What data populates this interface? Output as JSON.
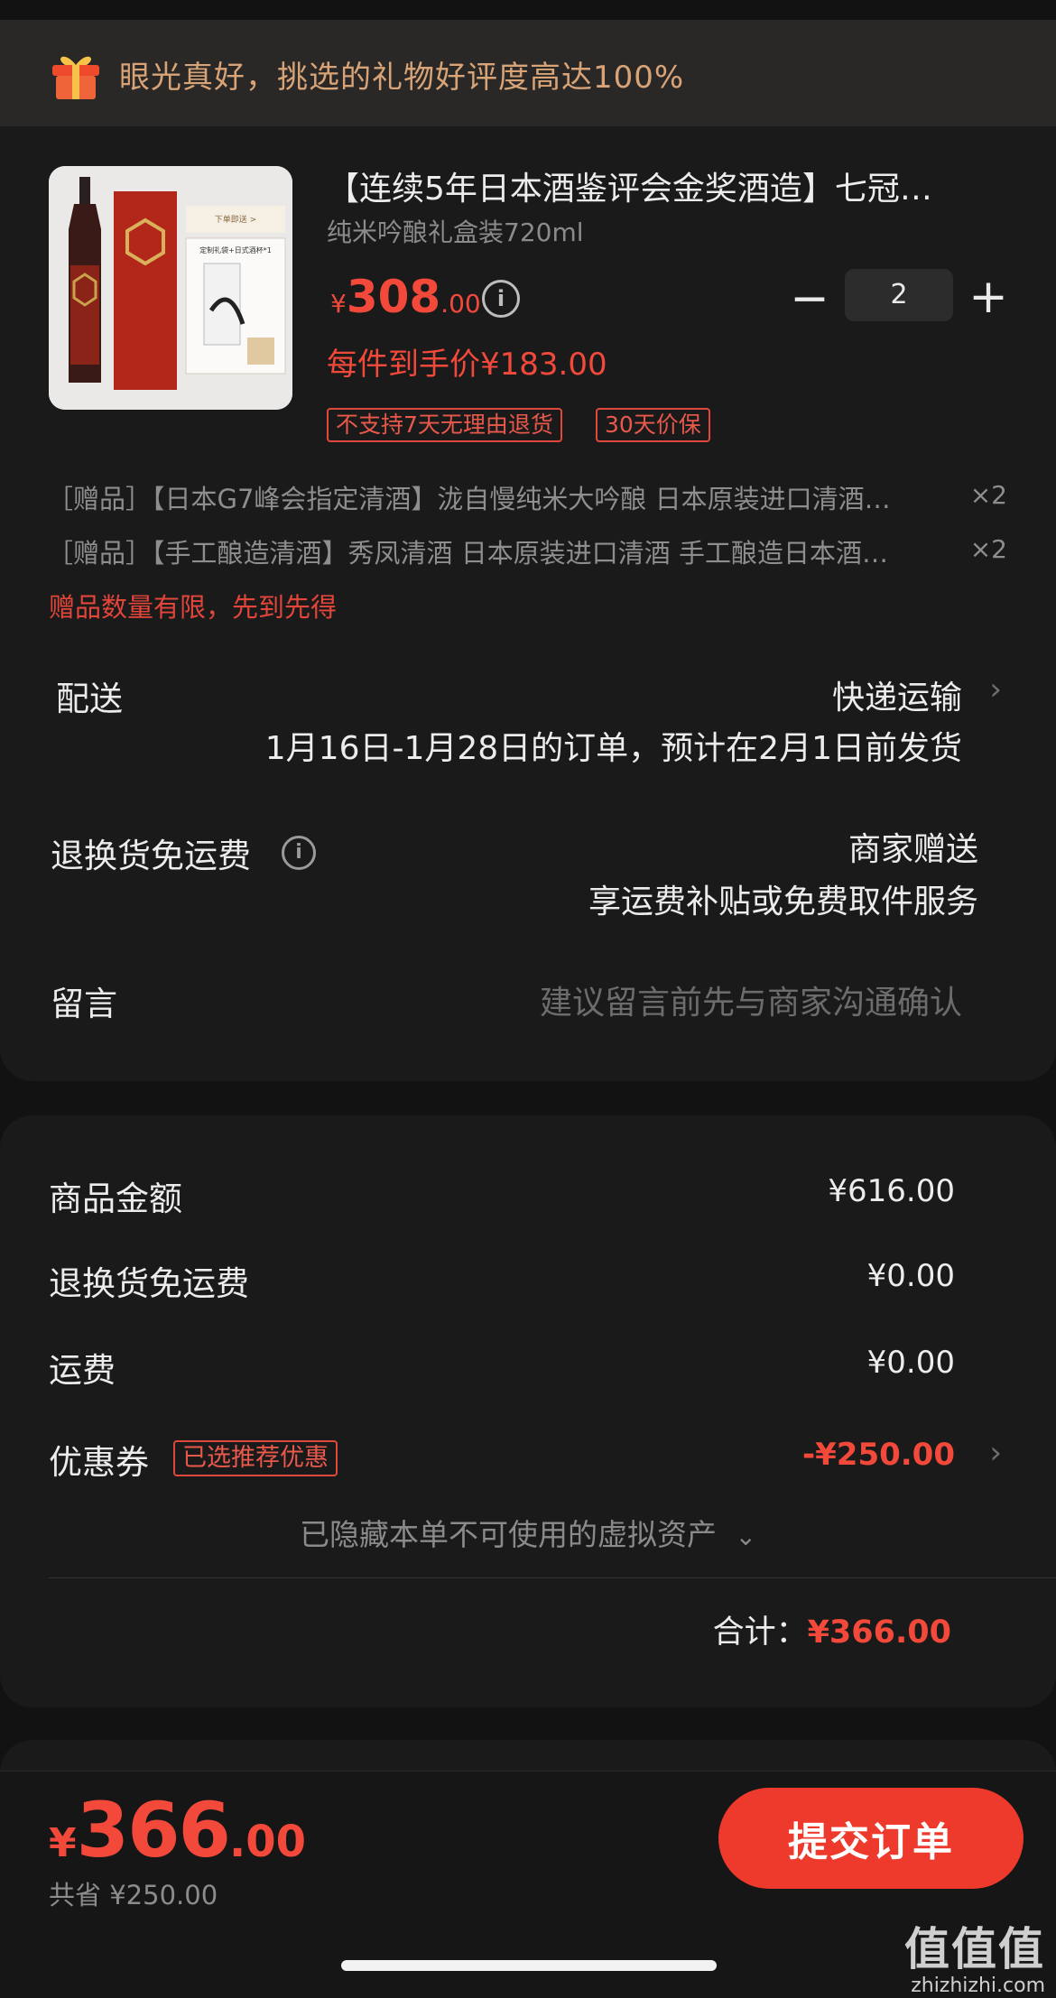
{
  "banner": {
    "text": "眼光真好，挑选的礼物好评度高达100%",
    "icon": "gift-icon"
  },
  "product": {
    "title": "【连续5年日本酒鉴评会金奖酒造】七冠…",
    "subtitle": "纯米吟酿礼盒装720ml",
    "price_currency": "¥",
    "price_int": "308",
    "price_dec": ".00",
    "unit_price": "每件到手价¥183.00",
    "tags": [
      "不支持7天无理由退货",
      "30天价保"
    ],
    "quantity": "2",
    "minus": "−",
    "plus": "+",
    "image_inset_lines": [
      "下单即送 >",
      "定制礼袋+日式酒杯*1"
    ]
  },
  "gifts": [
    {
      "text": "［赠品］【日本G7峰会指定清酒】泷自慢纯米大吟酿 日本原装进口清酒…",
      "qty": "×2"
    },
    {
      "text": "［赠品］【手工酿造清酒】秀凤清酒 日本原装进口清酒 手工酿造日本酒…",
      "qty": "×2"
    }
  ],
  "gift_note": "赠品数量有限，先到先得",
  "delivery": {
    "label": "配送",
    "method": "快递运输",
    "date_note": "1月16日-1月28日的订单，预计在2月1日前发货"
  },
  "return_shipping": {
    "label": "退换货免运费",
    "line1": "商家赠送",
    "line2": "享运费补贴或免费取件服务"
  },
  "message": {
    "label": "留言",
    "placeholder": "建议留言前先与商家沟通确认"
  },
  "summary": {
    "goods_label": "商品金额",
    "goods_value": "¥616.00",
    "return_label": "退换货免运费",
    "return_value": "¥0.00",
    "shipping_label": "运费",
    "shipping_value": "¥0.00",
    "coupon_label": "优惠券",
    "coupon_tag": "已选推荐优惠",
    "coupon_value": "-¥250.00",
    "hidden_assets": "已隐藏本单不可使用的虚拟资产",
    "total_label": "合计：",
    "total_value": "¥366.00"
  },
  "footer": {
    "price_currency": "¥",
    "price_int": "366",
    "price_dec": ".00",
    "saved": "共省 ¥250.00",
    "submit": "提交订单"
  },
  "watermark": {
    "main": "值值值",
    "sub": "zhizhizhi.com"
  },
  "colors": {
    "accent_red": "#f2493b",
    "banner_text": "#d8a477",
    "background": "#121212",
    "card": "#1b1a1a"
  }
}
